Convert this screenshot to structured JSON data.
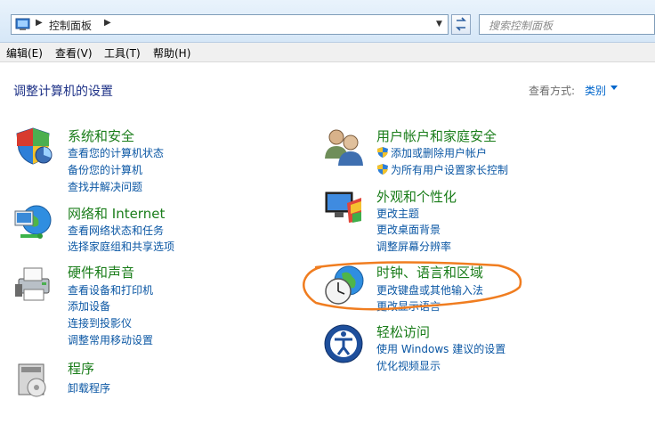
{
  "address": {
    "breadcrumb": "控制面板",
    "search_placeholder": "搜索控制面板"
  },
  "menu": [
    "编辑(E)",
    "查看(V)",
    "工具(T)",
    "帮助(H)"
  ],
  "page": {
    "title": "调整计算机的设置",
    "view_label": "查看方式:",
    "view_value": "类别"
  },
  "categories": {
    "system": {
      "title": "系统和安全",
      "links": [
        "查看您的计算机状态",
        "备份您的计算机",
        "查找并解决问题"
      ]
    },
    "network": {
      "title": "网络和 Internet",
      "links": [
        "查看网络状态和任务",
        "选择家庭组和共享选项"
      ]
    },
    "hardware": {
      "title": "硬件和声音",
      "links": [
        "查看设备和打印机",
        "添加设备",
        "连接到投影仪",
        "调整常用移动设置"
      ]
    },
    "programs": {
      "title": "程序",
      "links": [
        "卸载程序"
      ]
    },
    "users": {
      "title": "用户帐户和家庭安全",
      "links": [
        "添加或删除用户帐户",
        "为所有用户设置家长控制"
      ]
    },
    "appearance": {
      "title": "外观和个性化",
      "links": [
        "更改主题",
        "更改桌面背景",
        "调整屏幕分辨率"
      ]
    },
    "clock": {
      "title": "时钟、语言和区域",
      "links": [
        "更改键盘或其他输入法",
        "更改显示语言"
      ]
    },
    "ease": {
      "title": "轻松访问",
      "links": [
        "使用 Windows 建议的设置",
        "优化视频显示"
      ]
    }
  },
  "colors": {
    "title_green": "#1a7d1a",
    "link_blue": "#0b57a4",
    "heading_blue": "#1e3287",
    "annotation_orange": "#f07d20"
  }
}
